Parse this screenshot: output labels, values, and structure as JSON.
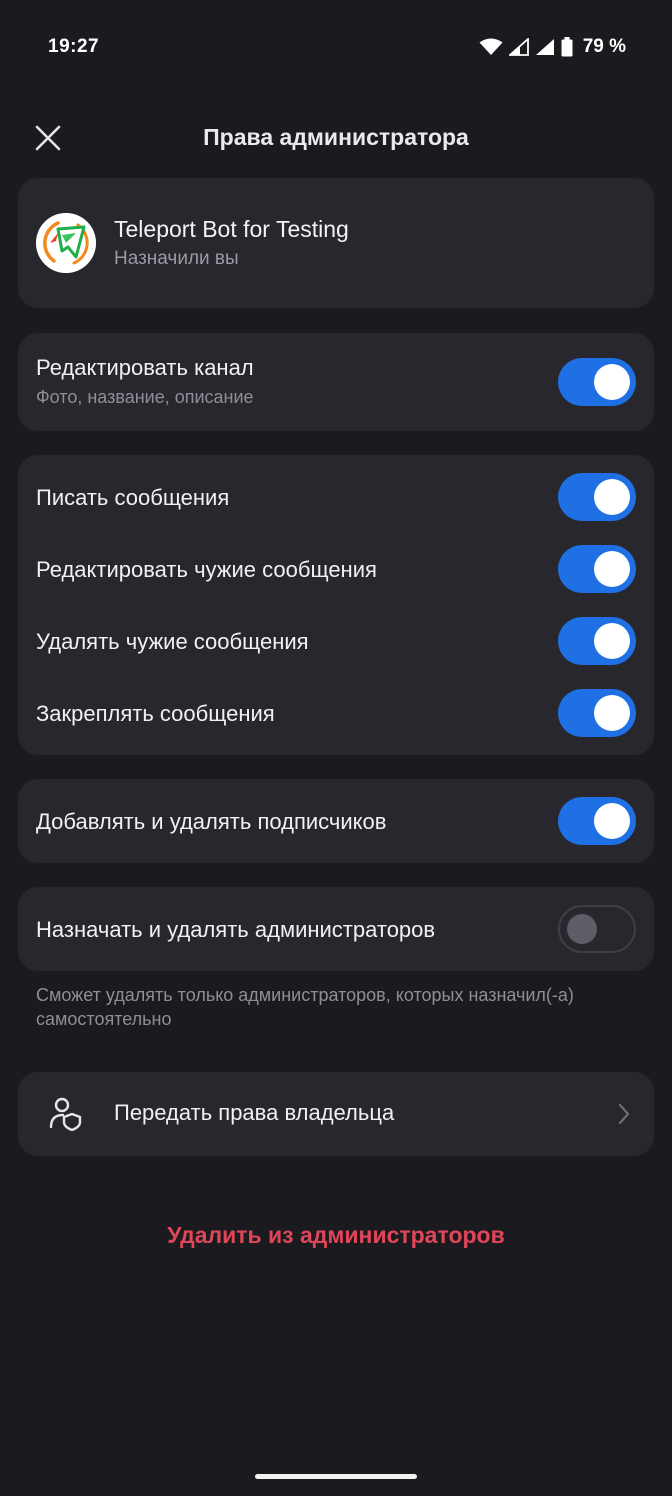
{
  "status_bar": {
    "time": "19:27",
    "battery_percent": "79 %",
    "icons": [
      "wifi-icon",
      "signal-icon",
      "signal-icon",
      "battery-icon"
    ]
  },
  "header": {
    "title": "Права администратора",
    "close_icon": "close-icon"
  },
  "bot": {
    "name": "Teleport Bot for Testing",
    "subtitle": "Назначили вы"
  },
  "permissions": {
    "edit_channel": {
      "label": "Редактировать канал",
      "sub": "Фото, название, описание",
      "enabled": true
    },
    "post_messages": {
      "label": "Писать сообщения",
      "enabled": true
    },
    "edit_others": {
      "label": "Редактировать чужие сообщения",
      "enabled": true
    },
    "delete_others": {
      "label": "Удалять чужие сообщения",
      "enabled": true
    },
    "pin_messages": {
      "label": "Закреплять сообщения",
      "enabled": true
    },
    "manage_subscribers": {
      "label": "Добавлять и удалять подписчиков",
      "enabled": true
    },
    "manage_admins": {
      "label": "Назначать и удалять администраторов",
      "enabled": false
    }
  },
  "hint": "Сможет удалять только администраторов, которых назначил(-а) самостоятельно",
  "transfer": {
    "label": "Передать права владельца",
    "icon": "user-shield-icon"
  },
  "remove_button": "Удалить из администраторов",
  "colors": {
    "background": "#1b1b1f",
    "card": "#27272d",
    "accent": "#1f6fe5",
    "danger": "#e0465a"
  }
}
